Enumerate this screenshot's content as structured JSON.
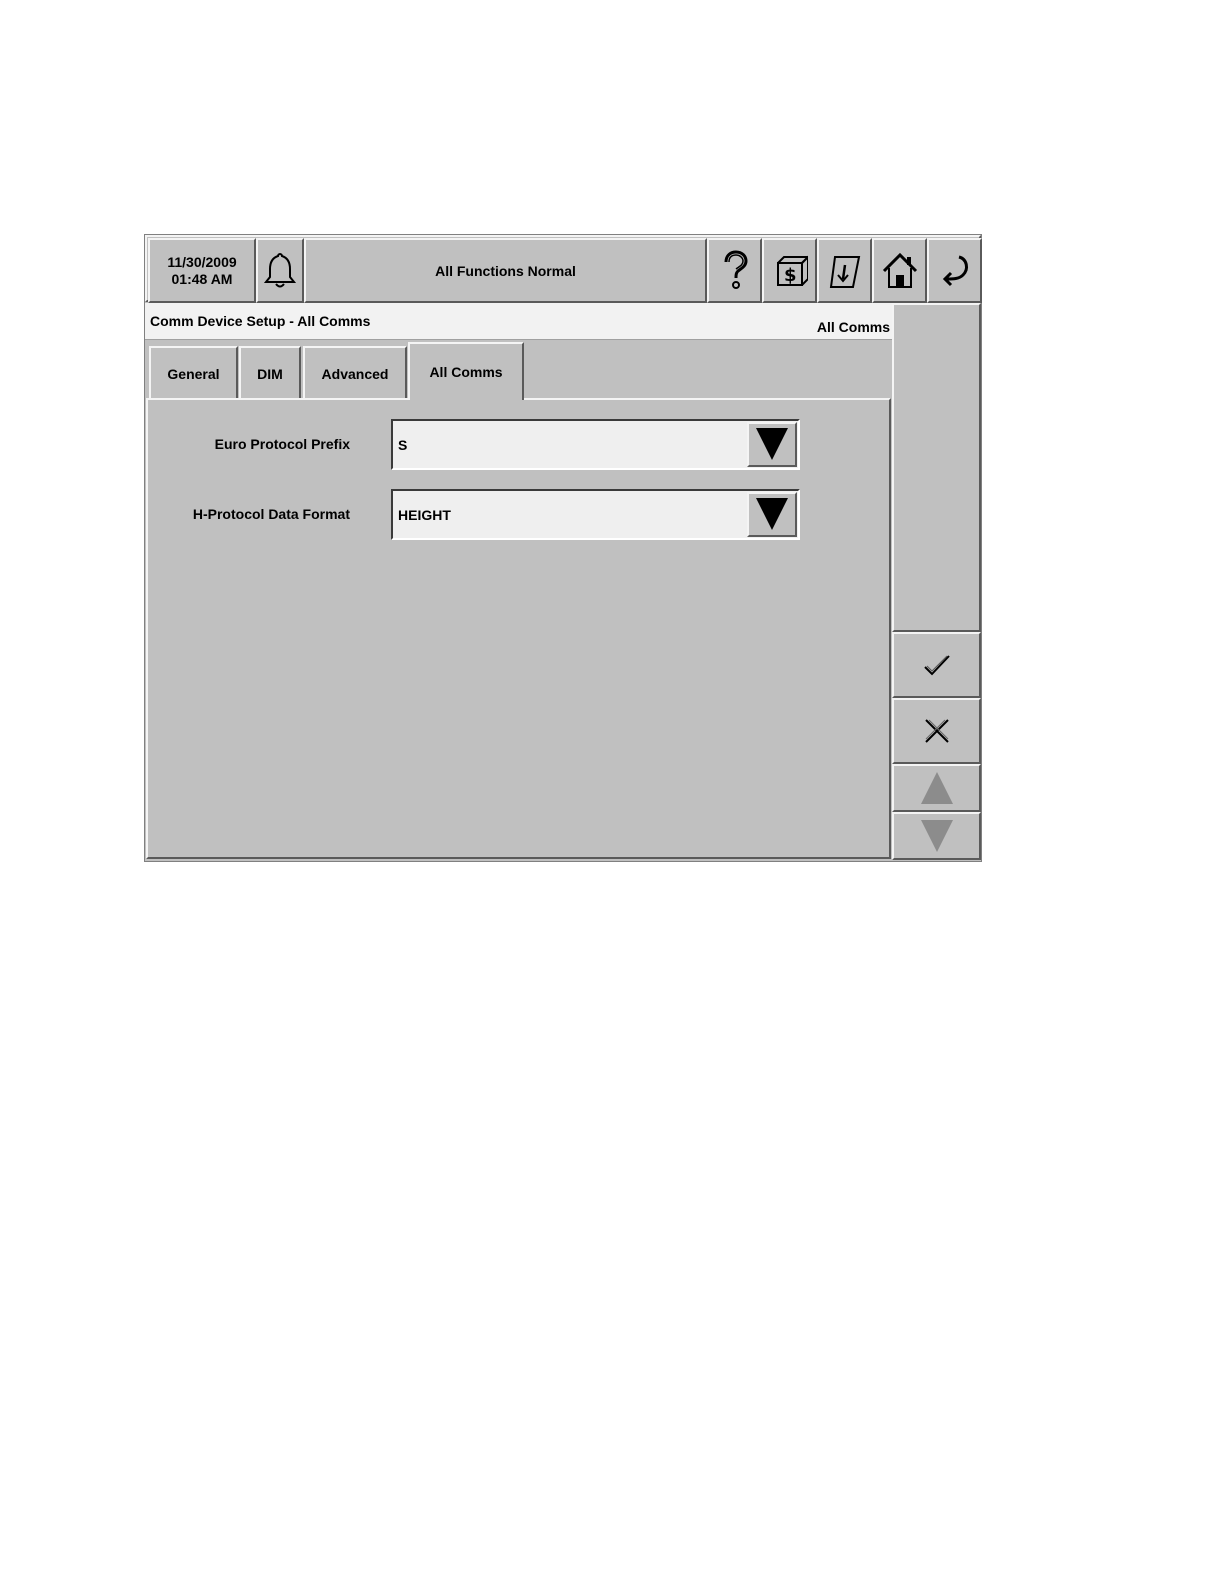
{
  "topbar": {
    "date": "11/30/2009",
    "time": "01:48 AM",
    "status": "All Functions Normal",
    "icons": [
      "bell-icon",
      "help-icon",
      "reports-icon",
      "print-icon",
      "home-icon",
      "back-icon"
    ]
  },
  "header": {
    "title": "Comm Device Setup - All Comms",
    "right_label": "All Comms"
  },
  "tabs": [
    {
      "label": "General"
    },
    {
      "label": "DIM"
    },
    {
      "label": "Advanced"
    },
    {
      "label": "All Comms",
      "active": true
    }
  ],
  "fields": [
    {
      "label": "Euro Protocol Prefix",
      "value": "S"
    },
    {
      "label": "H-Protocol Data Format",
      "value": "HEIGHT"
    }
  ],
  "side_buttons": [
    "accept-icon",
    "cancel-icon",
    "scroll-up-icon",
    "scroll-down-icon"
  ]
}
